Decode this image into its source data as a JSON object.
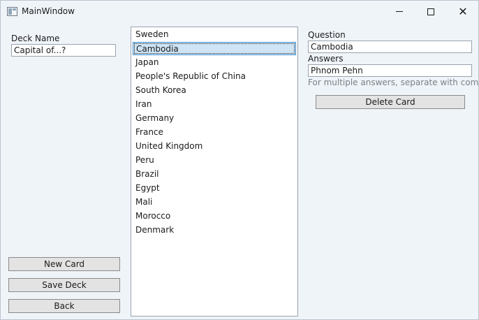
{
  "window": {
    "title": "MainWindow"
  },
  "deck": {
    "label": "Deck Name",
    "value": "Capital of...?"
  },
  "cards": [
    "Sweden",
    "Cambodia",
    "Japan",
    "People's Republic of China",
    "South Korea",
    "Iran",
    "Germany",
    "France",
    "United Kingdom",
    "Peru",
    "Brazil",
    "Egypt",
    "Mali",
    "Morocco",
    "Denmark"
  ],
  "selected_index": 1,
  "editor": {
    "question_label": "Question",
    "question_value": "Cambodia",
    "answers_label": "Answers",
    "answers_value": "Phnom Pehn",
    "hint": "For multiple answers, separate with commas",
    "delete_label": "Delete Card"
  },
  "actions": {
    "new_card": "New Card",
    "save_deck": "Save Deck",
    "back": "Back"
  }
}
